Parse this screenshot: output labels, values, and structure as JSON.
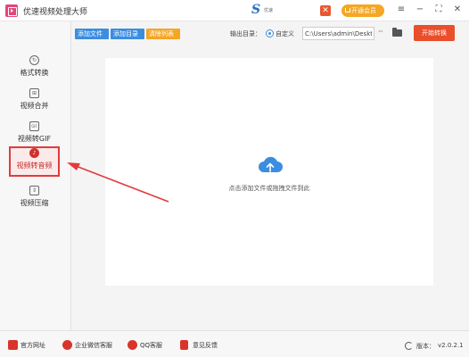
{
  "app": {
    "title": "优速视频处理大师"
  },
  "brand": {
    "logo_letter": "S",
    "tagline": "优速"
  },
  "header": {
    "vip_label": "开通会员",
    "gift_glyph": "✕"
  },
  "window_controls": {
    "menu": "≡",
    "minimize": "−",
    "maximize": "⛶",
    "close": "✕"
  },
  "sidebar": {
    "items": [
      {
        "label": "格式转换",
        "icon": "format-convert-icon",
        "glyph": "↻"
      },
      {
        "label": "视频合并",
        "icon": "video-merge-icon",
        "glyph": "⊞"
      },
      {
        "label": "视频转GIF",
        "icon": "gif-icon",
        "glyph": "GIF"
      },
      {
        "label": "视频转音频",
        "icon": "audio-icon",
        "glyph": "♪",
        "active": true
      },
      {
        "label": "视频压缩",
        "icon": "compress-icon",
        "glyph": "⇕"
      }
    ]
  },
  "toolbar": {
    "add_file": "添加文件",
    "add_folder": "添加目录",
    "clear_list": "清除列表"
  },
  "output": {
    "label": "输出目录：",
    "option_label": "自定义",
    "path": "C:\\Users\\admin\\Deskto",
    "more": "···",
    "start_button": "开始转换"
  },
  "dropzone": {
    "hint": "点击添加文件或拖拽文件到此"
  },
  "footer": {
    "site": "官方网址",
    "wechat": "企业微信客服",
    "qq": "QQ客服",
    "feedback": "意见反馈",
    "version_label": "版本：",
    "version_value": "v2.0.2.1"
  },
  "colors": {
    "accent_blue": "#3b8de0",
    "accent_orange": "#f5a623",
    "start_red": "#ea4e2a",
    "highlight_red": "#e23b3b"
  }
}
